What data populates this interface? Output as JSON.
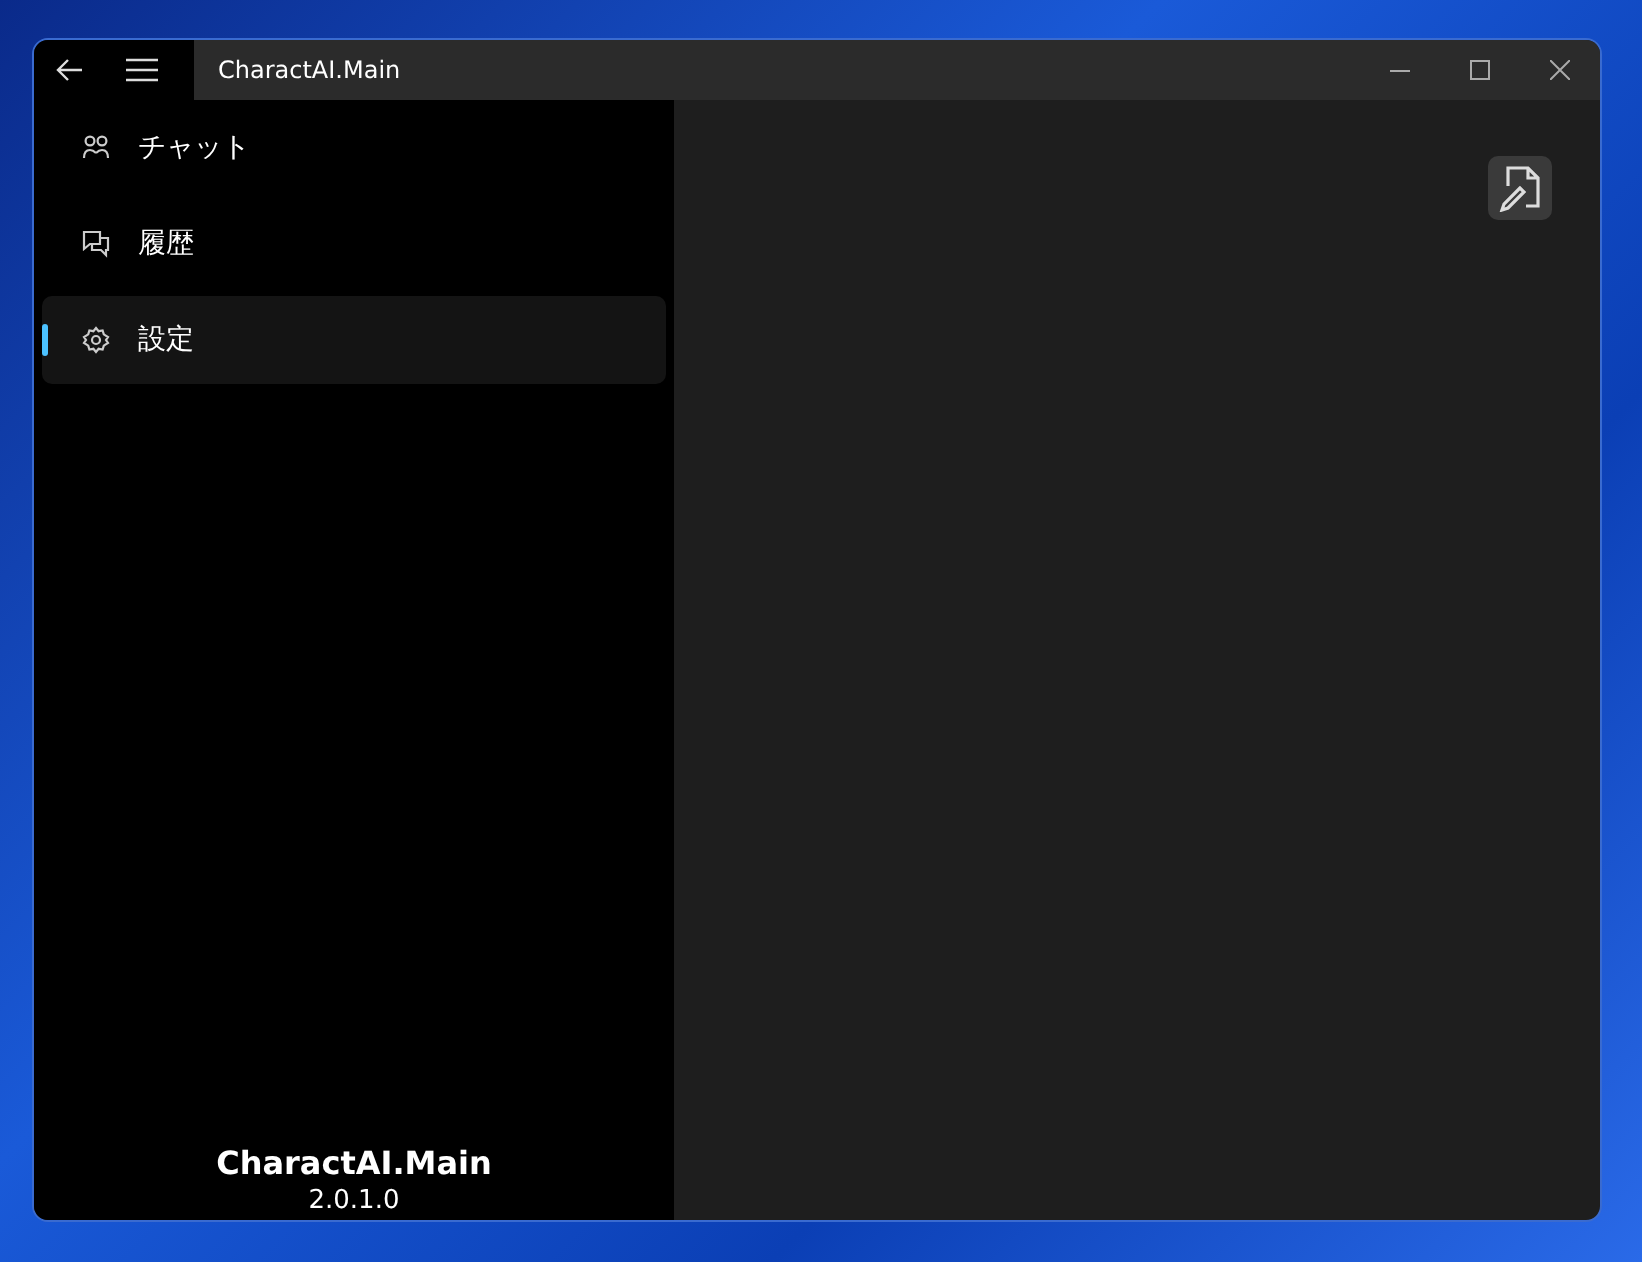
{
  "window": {
    "title": "CharactAI.Main"
  },
  "sidebar": {
    "items": [
      {
        "label": "チャット",
        "kind": "chat",
        "selected": false
      },
      {
        "label": "履歴",
        "kind": "history",
        "selected": false
      },
      {
        "label": "設定",
        "kind": "settings",
        "selected": true
      }
    ],
    "footer": {
      "app_name": "CharactAI.Main",
      "version": "2.0.1.0"
    }
  }
}
